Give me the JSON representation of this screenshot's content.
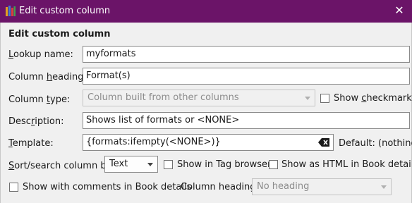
{
  "window": {
    "title": "Edit custom column",
    "close_label": "✕",
    "app_icon": "books-icon"
  },
  "heading": "Edit custom column",
  "lookup": {
    "label": "Lookup name:",
    "underline": "L",
    "rest": "ookup name:",
    "value": "myformats"
  },
  "col_heading": {
    "label": "Column heading:",
    "pre": "Column ",
    "underline": "h",
    "rest": "eading:",
    "value": "Format(s)"
  },
  "col_type": {
    "pre": "Column ",
    "underline": "t",
    "rest": "ype:",
    "value": "Column built from other columns"
  },
  "show_checkmarks": {
    "pre": "Show ",
    "underline": "c",
    "rest": "heckmarks",
    "checked": false
  },
  "description": {
    "pre": "Desc",
    "underline": "r",
    "rest": "iption:",
    "value": "Shows list of formats or <NONE>"
  },
  "template": {
    "underline": "T",
    "rest": "emplate:",
    "value": "{formats:ifempty(<NONE>)}",
    "default_text": "Default: (nothing)",
    "clear_icon": "clear-text-icon"
  },
  "sort_search": {
    "underline": "S",
    "rest": "ort/search column by",
    "value": "Text"
  },
  "show_tag_browser": {
    "label": "Show in Tag browser",
    "checked": false
  },
  "show_html": {
    "label": "Show as HTML in Book details",
    "checked": false
  },
  "show_comments": {
    "label": "Show with comments in Book details",
    "checked": false
  },
  "column_heading_select": {
    "label": "Column heading:",
    "value": "No heading"
  }
}
